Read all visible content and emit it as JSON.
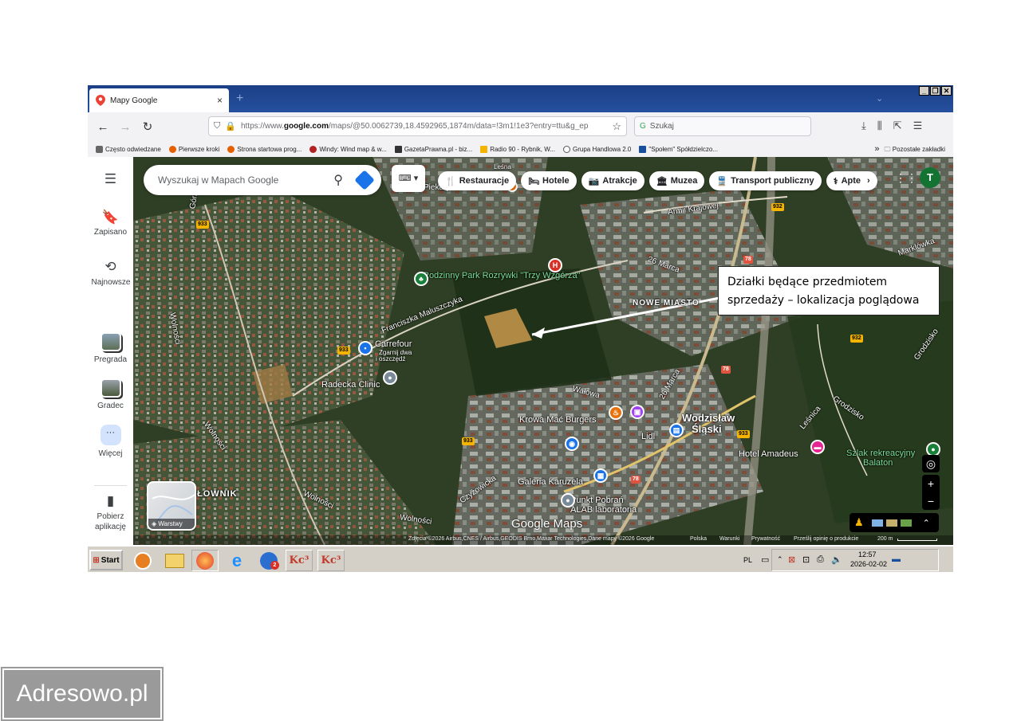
{
  "browser": {
    "tab_title": "Mapy Google",
    "tab_close": "×",
    "new_tab": "+",
    "url_prefix": "https://www.",
    "url_domain": "google.com",
    "url_rest": "/maps/@50.0062739,18.4592965,1874m/data=!3m1!1e3?entry=ttu&g_ep",
    "search_placeholder": "Szukaj",
    "bookmarks": [
      {
        "label": "Często odwiedzane",
        "color": "#666666"
      },
      {
        "label": "Pierwsze kroki",
        "color": "#e66000"
      },
      {
        "label": "Strona startowa prog...",
        "color": "#e66000"
      },
      {
        "label": "Windy: Wind map & w...",
        "color": "#b22222"
      },
      {
        "label": "GazetaPrawna.pl - biz...",
        "color": "#333333"
      },
      {
        "label": "Radio 90 - Rybnik, W...",
        "color": "#f4b400"
      },
      {
        "label": "Grupa Handlowa 2.0",
        "color": "#555555"
      },
      {
        "label": "\"Społem\" Spółdzielczo...",
        "color": "#1a4fa0"
      }
    ],
    "bookmarks_more": "Pozostałe zakładki"
  },
  "sidebar": {
    "saved": "Zapisano",
    "recent": "Najnowsze",
    "place1": "Pregrada",
    "place2": "Gradec",
    "more": "Więcej",
    "download": "Pobierz aplikację"
  },
  "maps": {
    "search_placeholder": "Wyszukaj w Mapach Google",
    "chips": [
      {
        "icon": "fork-knife-icon",
        "glyph": "🍴",
        "label": "Restauracje"
      },
      {
        "icon": "bed-icon",
        "glyph": "🛏",
        "label": "Hotele"
      },
      {
        "icon": "camera-icon",
        "glyph": "📷",
        "label": "Atrakcje"
      },
      {
        "icon": "museum-icon",
        "glyph": "🏛",
        "label": "Muzea"
      },
      {
        "icon": "train-icon",
        "glyph": "🚆",
        "label": "Transport publiczny"
      },
      {
        "icon": "pharmacy-icon",
        "glyph": "⚕",
        "label": "Apte"
      }
    ],
    "avatar_letter": "T",
    "layers_label": "Warstwy",
    "logo": "Google Maps",
    "labels": {
      "park": "Rodzinny Park Rozrywki \"Trzy Wzgórza\"",
      "carrefour": "Carrefour",
      "carrefour_sub1": "Zgarnij dwa",
      "carrefour_sub2": "i oszczędź",
      "radecka": "Radecka Clinic",
      "krowa": "Krowa Mać Burgers",
      "lidl": "Lidl",
      "galeria": "Galeria Karuzela",
      "punkt1": "Punkt Pobrań",
      "punkt2": "ALAB laboratoria",
      "hotel": "Hotel Amadeus",
      "szlak1": "Szlak rekreacyjny",
      "szlak2": "Balaton",
      "city1": "Wodzisław",
      "city2": "Śląski",
      "nowe": "NOWE MIASTO",
      "armii": "Armii Krajowej",
      "marca1": "26 Marca",
      "marca2": "26 Marca",
      "maluszczyka": "Franciszka Maluszczyka",
      "walowa": "Wałowa",
      "wolnosci1": "Wolności",
      "wolnosci2": "Wolności",
      "wolnosci3": "Wolności",
      "wolnosci4": "Wolności",
      "czyzowicka": "Czyżowicka",
      "lesnica": "Leśnica",
      "grodzisko1": "Grodzisko",
      "grodzisko2": "Grodzisko",
      "marklowka": "Marklówka",
      "piekary": "Piekary",
      "lesna": "Leśna",
      "gornicza": "Górnicza",
      "wodzis_small": "Wodzisław",
      "olownik": "ŁOWNIK"
    },
    "shields": [
      "933",
      "933",
      "933",
      "933",
      "932",
      "932",
      "78",
      "78",
      "78"
    ],
    "annotation_line1": "Działki będące przedmiotem",
    "annotation_line2": "sprzedaży – lokalizacja poglądowa",
    "footer": {
      "attribution": "Zdjęcia ©2026 Airbus,CNES / Airbus,GEODIS Brno,Maxar Technologies,Dane mapy ©2026 Google",
      "country": "Polska",
      "terms": "Warunki",
      "privacy": "Prywatność",
      "feedback": "Prześlij opinię o produkcie",
      "scale": "200 m"
    }
  },
  "taskbar": {
    "start": "Start",
    "lang": "PL",
    "time": "12:57",
    "date": "2026-02-02",
    "badge": "2",
    "kc": "Kc³"
  },
  "watermark": "Adresowo.pl"
}
